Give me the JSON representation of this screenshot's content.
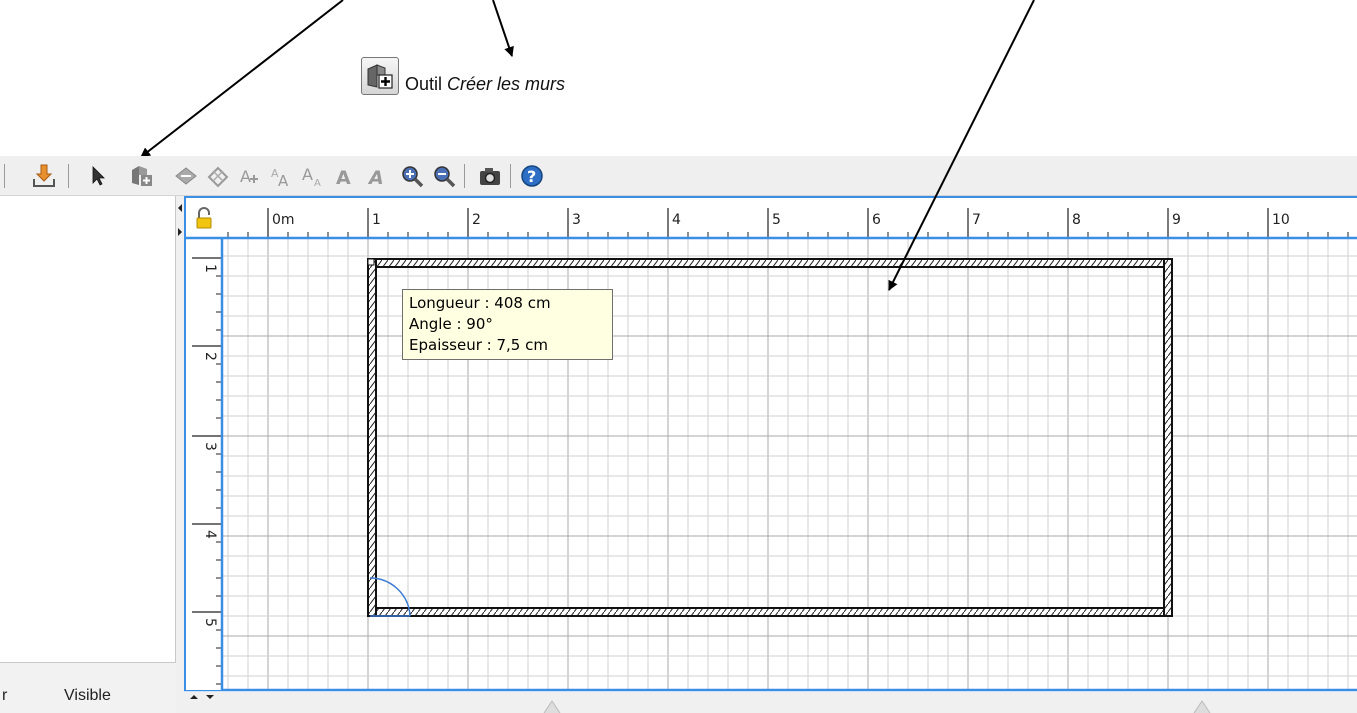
{
  "caption": {
    "prefix": "Outil",
    "tool_name": "Créer les murs",
    "icon": "create-walls-icon"
  },
  "toolbar": {
    "buttons": [
      {
        "name": "import-furniture-button",
        "icon": "import-arrow-icon"
      },
      {
        "name": "select-button",
        "icon": "pointer-arrow-icon"
      },
      {
        "name": "create-walls-button",
        "icon": "create-walls-icon"
      },
      {
        "name": "create-rooms-button",
        "icon": "create-rooms-icon"
      },
      {
        "name": "create-dimensions-button",
        "icon": "create-dimensions-icon"
      },
      {
        "name": "add-text-button",
        "icon": "add-text-icon"
      },
      {
        "name": "increase-text-size-button",
        "icon": "text-size-up-icon"
      },
      {
        "name": "decrease-text-size-button",
        "icon": "text-size-down-icon"
      },
      {
        "name": "bold-text-button",
        "icon": "bold-text-icon"
      },
      {
        "name": "italic-text-button",
        "icon": "italic-text-icon"
      },
      {
        "name": "zoom-in-button",
        "icon": "zoom-in-icon"
      },
      {
        "name": "zoom-out-button",
        "icon": "zoom-out-icon"
      },
      {
        "name": "create-photo-button",
        "icon": "camera-icon"
      },
      {
        "name": "help-button",
        "icon": "help-icon"
      }
    ]
  },
  "left_panel": {
    "column_partial": "r",
    "column_visible": "Visible"
  },
  "ruler": {
    "x_labels": [
      "0m",
      "1",
      "2",
      "3",
      "4",
      "5",
      "6",
      "7",
      "8",
      "9",
      "10"
    ],
    "y_labels": [
      "1",
      "2",
      "3",
      "4",
      "5"
    ]
  },
  "tooltip": {
    "length": "Longueur : 408 cm",
    "angle": "Angle : 90°",
    "thickness": "Epaisseur : 7,5 cm"
  },
  "colors": {
    "selection_blue": "#3a8ee6",
    "grid_major": "#a8a8a8",
    "grid_minor": "#d2d2d2",
    "wall": "#111111",
    "tooltip_bg": "#ffffe1"
  }
}
